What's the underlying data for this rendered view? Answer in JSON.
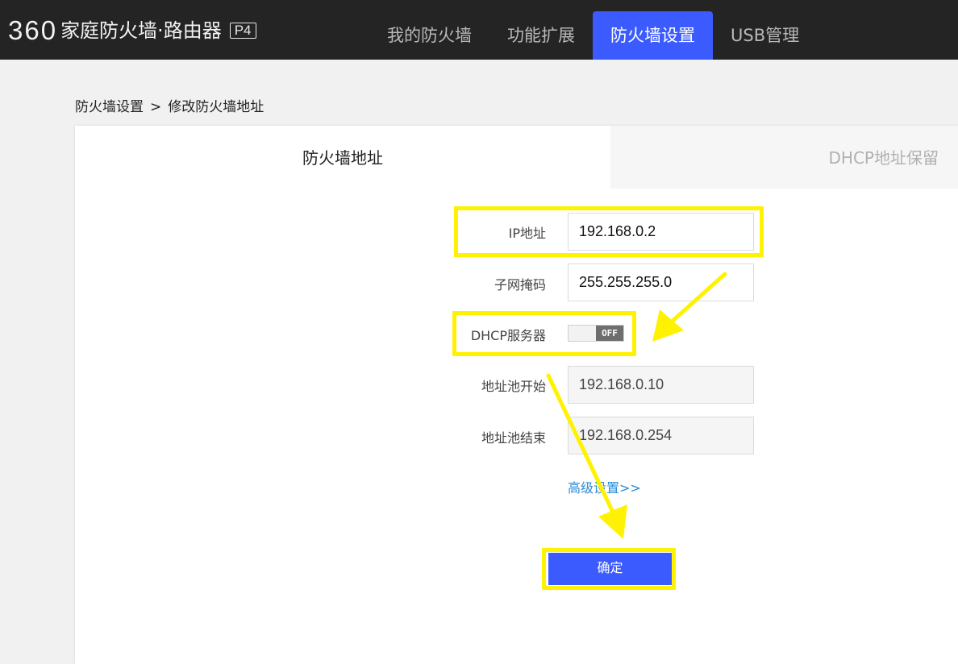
{
  "header": {
    "brand_number": "360",
    "brand_name": "家庭防火墙·路由器",
    "model_badge": "P4",
    "nav_tabs": [
      {
        "label": "我的防火墙",
        "active": false
      },
      {
        "label": "功能扩展",
        "active": false
      },
      {
        "label": "防火墙设置",
        "active": true
      },
      {
        "label": "USB管理",
        "active": false
      }
    ]
  },
  "breadcrumb": {
    "parent": "防火墙设置",
    "separator": ">",
    "current": "修改防火墙地址"
  },
  "tabs": {
    "firewall_address": "防火墙地址",
    "dhcp_reservation": "DHCP地址保留"
  },
  "form": {
    "ip_label": "IP地址",
    "ip_value": "192.168.0.2",
    "mask_label": "子网掩码",
    "mask_value": "255.255.255.0",
    "dhcp_label": "DHCP服务器",
    "dhcp_state": "OFF",
    "pool_start_label": "地址池开始",
    "pool_start_value": "192.168.0.10",
    "pool_end_label": "地址池结束",
    "pool_end_value": "192.168.0.254",
    "advanced_link": "高级设置>>",
    "confirm_label": "确定"
  },
  "colors": {
    "accent": "#3b5bff",
    "topbar": "#242424",
    "highlight": "#fff200",
    "link": "#2a8ad4"
  }
}
